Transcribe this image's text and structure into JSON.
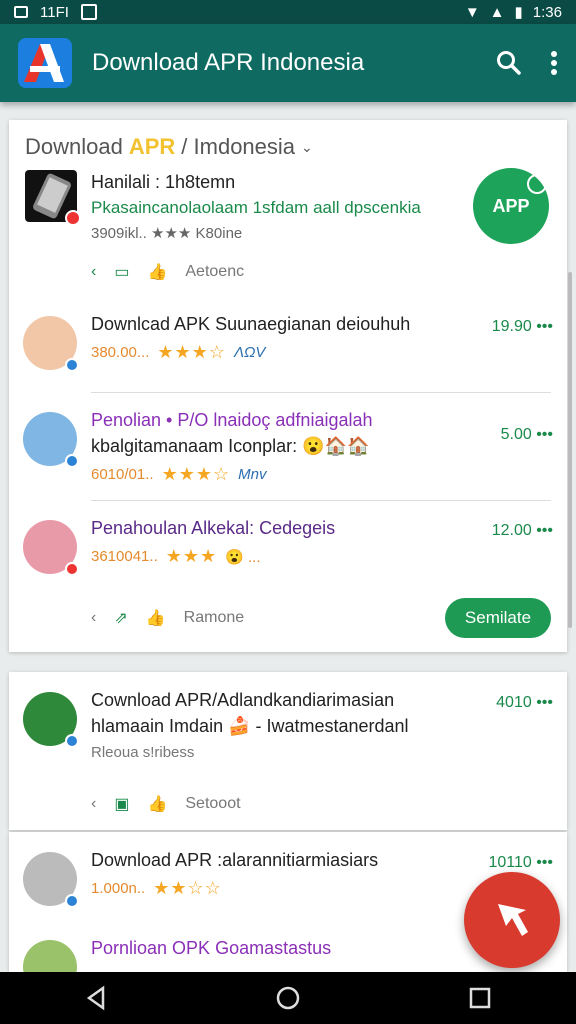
{
  "status": {
    "left": "11FI",
    "time": "1:36"
  },
  "appbar": {
    "title": "Download APR Indonesia"
  },
  "section_header": {
    "prefix": "Download",
    "accent": "APR",
    "suffix": "/ Imdonesia"
  },
  "featured": {
    "title": "Hanilali : 1h8temn",
    "subtitle": "Pkasaincanolaolaam 1sfdam aall dpscenkia",
    "meta": "3909ikl.. ★★★ K80ine",
    "badge": "APP",
    "actions": [
      "‹",
      "Aetoenc"
    ]
  },
  "items": [
    {
      "title": "Downlcad APK Suunaegianan deiouhuh",
      "meta": "380.00...",
      "rating_stars": "★★★☆",
      "tag": "ΛΩV",
      "price": "19.90 •••"
    },
    {
      "title": "Penolian • P/O lnaidoç adfniaigalah",
      "title2": "kbalgitamanaam Iconplar: 😮🏠🏠",
      "meta": "6010/01..",
      "rating_stars": "★★★☆",
      "tag": "Mnv",
      "price": "5.00 •••"
    },
    {
      "title": "Penahoulan Alkekal: Cedegeis",
      "meta": "3610041..",
      "rating_stars": "★★★",
      "tag": "😮 ...",
      "price": "12.00 •••"
    }
  ],
  "card1_actions": [
    "‹",
    "Ramone"
  ],
  "simulate_button": "Semilate",
  "card2": {
    "title": "Cownload APR/Adlandkandiarimasian",
    "subtitle": "hlamaain Imdain 🍰 - Iwatmestanerdanl",
    "meta": "Rleoua s!ribess",
    "price": "4010 •••",
    "actions": [
      "‹",
      "Setooot"
    ]
  },
  "card3": [
    {
      "title": "Download APR :alarannitiarmiasiars",
      "meta": "1.000n..",
      "rating_stars": "★★☆☆",
      "price": "10110 •••"
    },
    {
      "title": "Pornlioan OPK Goamastastus"
    }
  ],
  "colors": {
    "appbar": "#0f6b62",
    "statusbar": "#0b4b45",
    "accent_green": "#1ea45a",
    "fab": "#d83a2e"
  }
}
